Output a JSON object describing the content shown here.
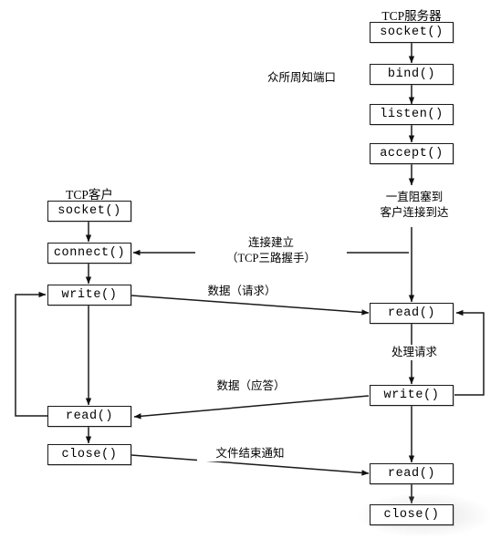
{
  "diagram": {
    "title_client": "TCP客户",
    "title_server": "TCP服务器",
    "server_nodes": [
      {
        "id": "srv-socket",
        "label": "socket()"
      },
      {
        "id": "srv-bind",
        "label": "bind()"
      },
      {
        "id": "srv-listen",
        "label": "listen()"
      },
      {
        "id": "srv-accept",
        "label": "accept()"
      },
      {
        "id": "srv-read1",
        "label": "read()"
      },
      {
        "id": "srv-write",
        "label": "write()"
      },
      {
        "id": "srv-read2",
        "label": "read()"
      },
      {
        "id": "srv-close",
        "label": "close()"
      }
    ],
    "client_nodes": [
      {
        "id": "cli-socket",
        "label": "socket()"
      },
      {
        "id": "cli-connect",
        "label": "connect()"
      },
      {
        "id": "cli-write",
        "label": "write()"
      },
      {
        "id": "cli-read",
        "label": "read()"
      },
      {
        "id": "cli-close",
        "label": "close()"
      }
    ],
    "annotations": {
      "well_known_port": "众所周知端口",
      "block_until_line1": "一直阻塞到",
      "block_until_line2": "客户连接到达",
      "connection_established_line1": "连接建立",
      "connection_established_line2": "（TCP三路握手）",
      "data_request": "数据（请求）",
      "process_request": "处理请求",
      "data_reply": "数据（应答）",
      "eof_notification": "文件结束通知"
    },
    "colors": {
      "stroke": "#1a1a1a",
      "background": "#ffffff",
      "text": "#000000"
    }
  }
}
